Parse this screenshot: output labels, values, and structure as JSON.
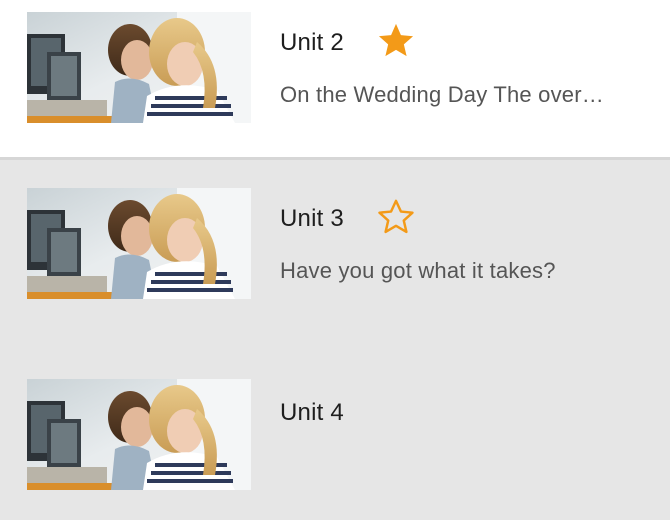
{
  "lessons": [
    {
      "unit_label": "Unit 2",
      "description": "On the Wedding Day The over…",
      "favorite": true,
      "star_icon": "star-filled-icon",
      "thumbnail": "two-students-at-computer"
    },
    {
      "unit_label": "Unit 3",
      "description": "Have you got what it takes?",
      "favorite": false,
      "star_icon": "star-outline-icon",
      "thumbnail": "two-students-at-computer"
    },
    {
      "unit_label": "Unit 4",
      "description": "",
      "thumbnail": "two-students-at-computer"
    }
  ],
  "colors": {
    "star": "#f39a18",
    "selected_row_bg": "#ffffff",
    "row_bg": "#e6e6e6",
    "title_text": "#1e1e1e",
    "desc_text": "#555555"
  }
}
